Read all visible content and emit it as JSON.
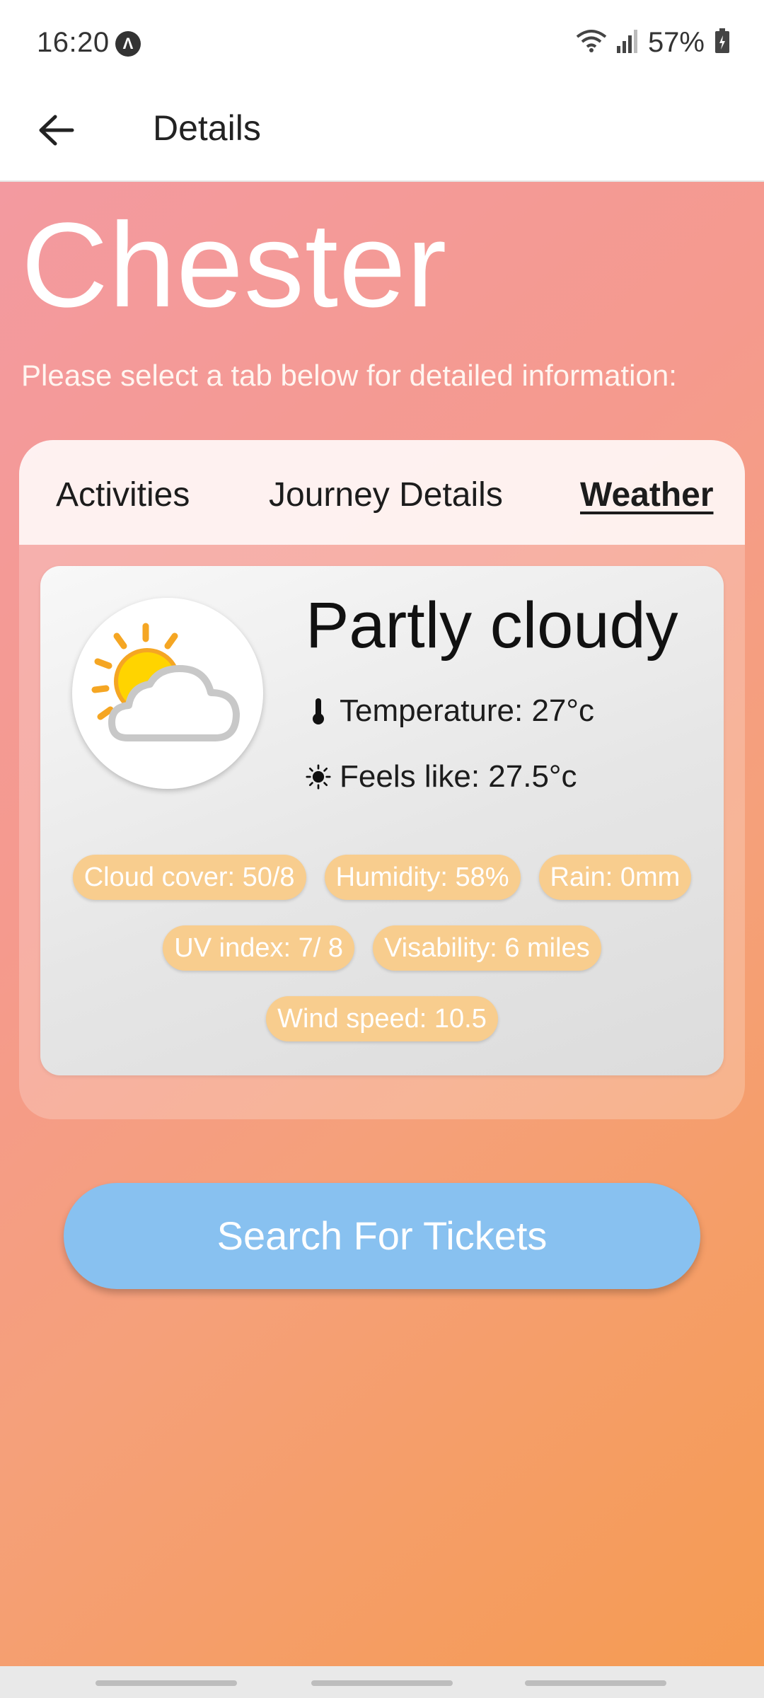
{
  "status_bar": {
    "time": "16:20",
    "battery": "57%",
    "icons": [
      "app-notification-icon",
      "wifi-icon",
      "signal-icon",
      "battery-icon"
    ]
  },
  "app_bar": {
    "back_icon": "arrow-left-icon",
    "title": "Details"
  },
  "page": {
    "city": "Chester",
    "subtitle": "Please select a tab below for detailed information:"
  },
  "tabs": {
    "items": [
      {
        "label": "Activities",
        "active": false
      },
      {
        "label": "Journey Details",
        "active": false
      },
      {
        "label": "Weather",
        "active": true
      }
    ]
  },
  "weather": {
    "icon": "partly-cloudy-icon",
    "condition": "Partly cloudy",
    "temperature": "Temperature: 27°c",
    "feels_like": "Feels like: 27.5°c",
    "chips": [
      "Cloud cover: 50/8",
      "Humidity: 58%",
      "Rain: 0mm",
      "UV index: 7/ 8",
      "Visability: 6 miles",
      "Wind speed: 10.5"
    ]
  },
  "actions": {
    "search_label": "Search For Tickets"
  },
  "colors": {
    "gradient_start": "#f39aa0",
    "gradient_end": "#f59b52",
    "chip": "#f8cd8e",
    "button": "#88c1f0"
  }
}
